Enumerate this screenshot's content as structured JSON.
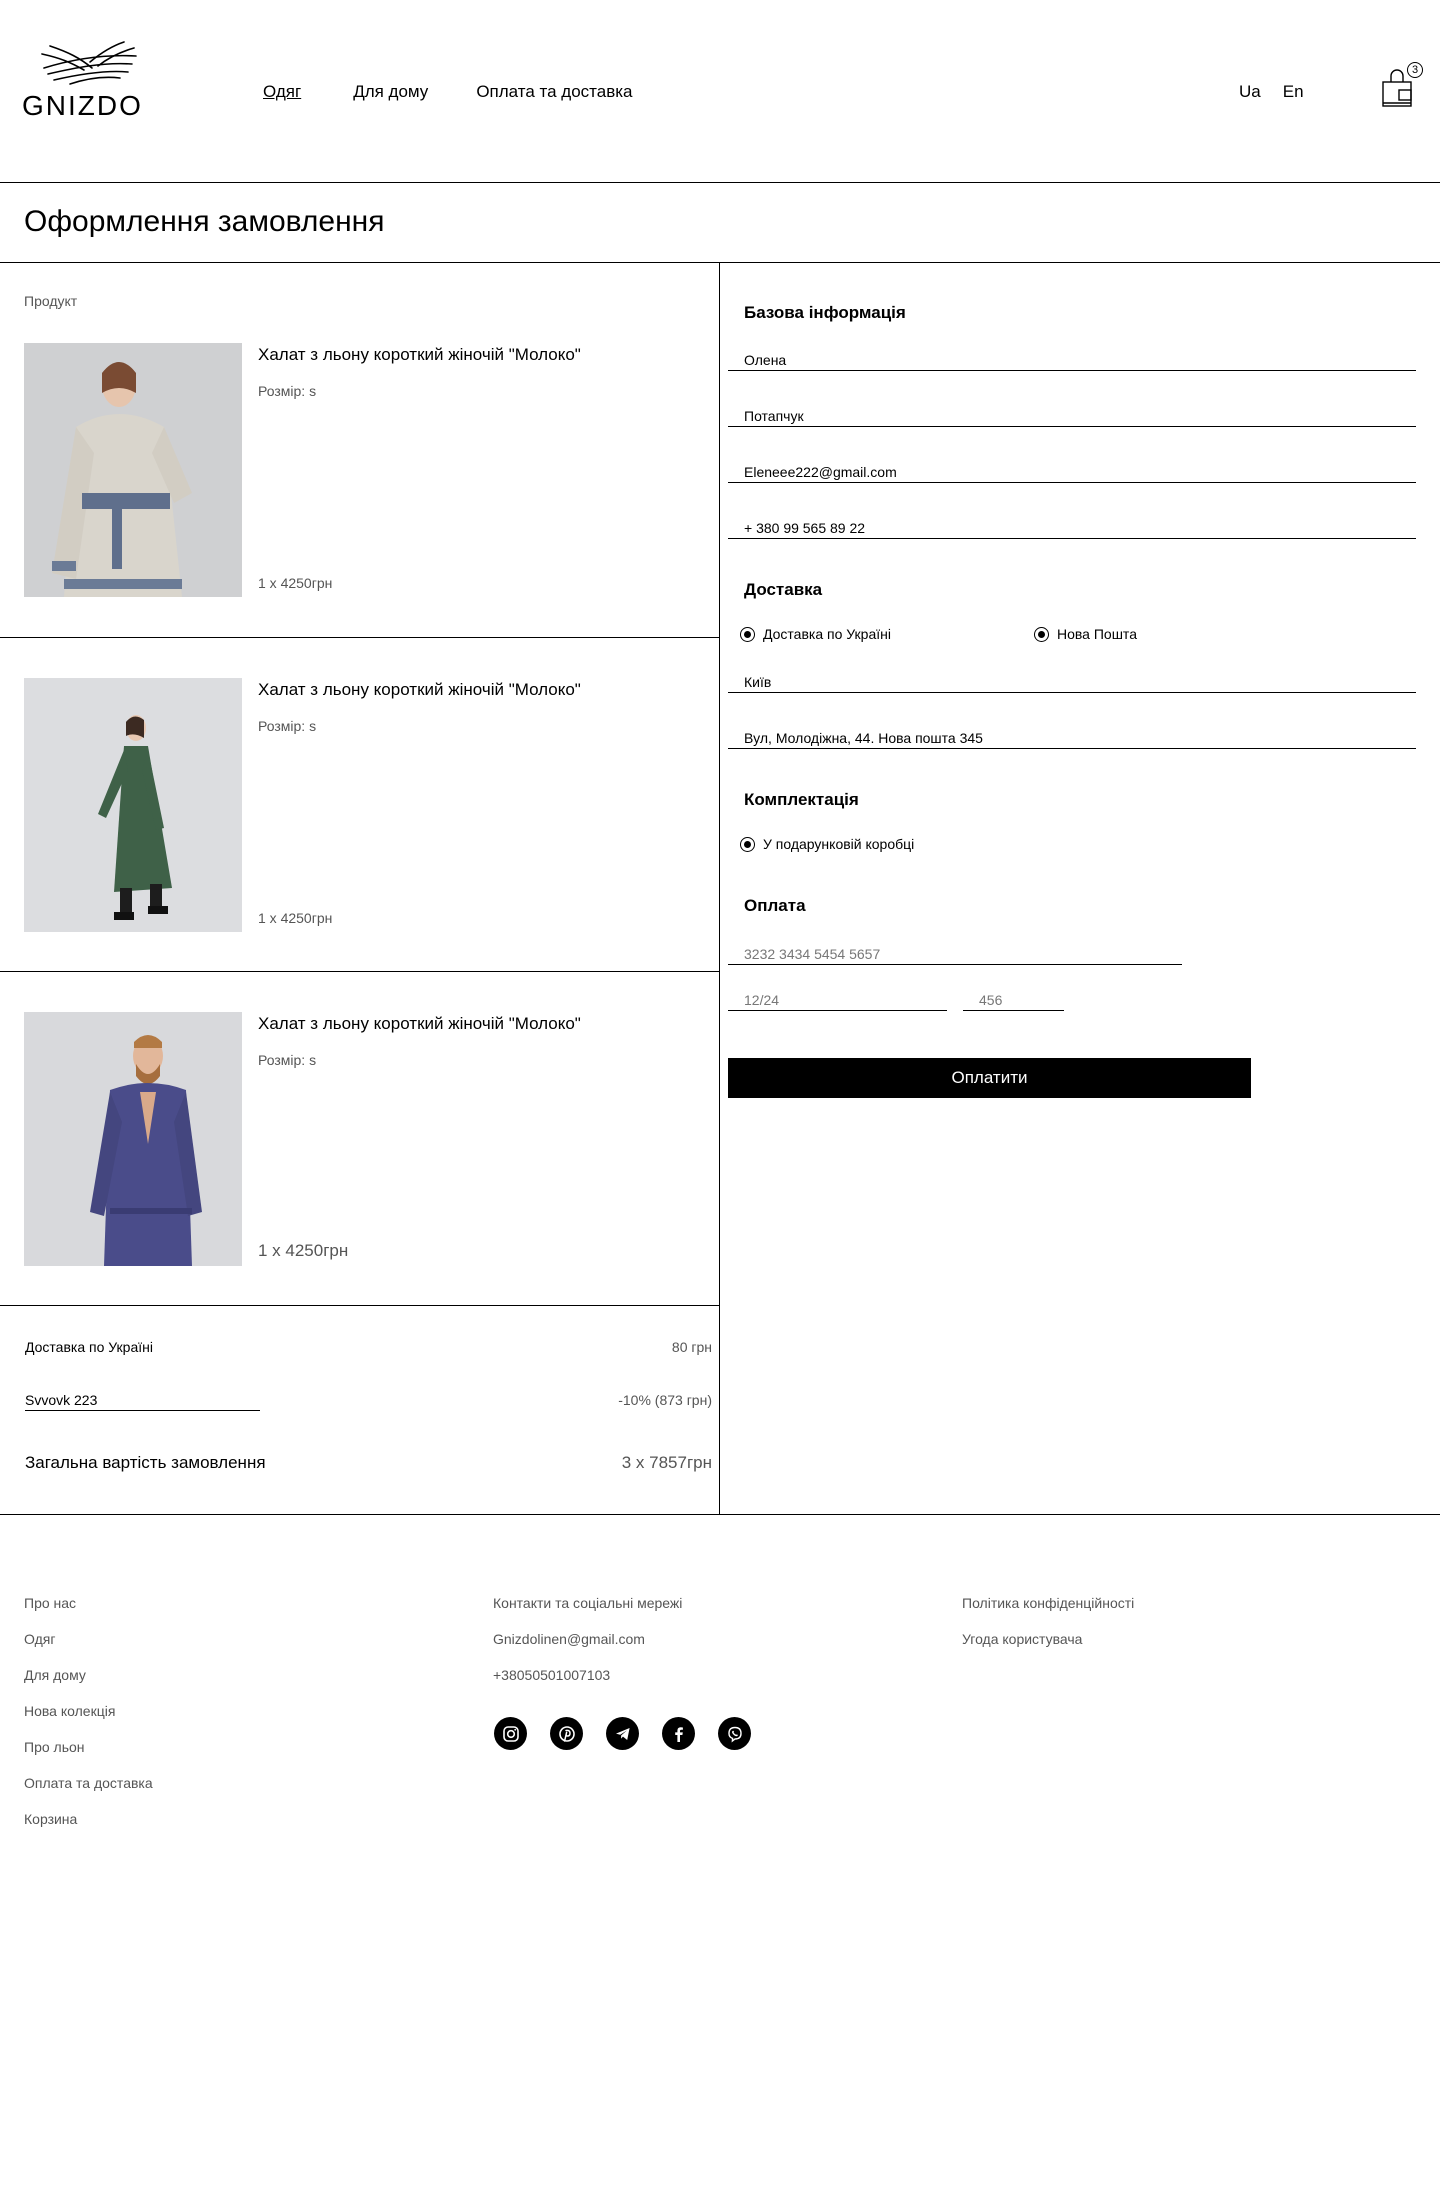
{
  "header": {
    "logo_text": "GNIZDO",
    "nav": [
      "Одяг",
      "Для дому",
      "Оплата та доставка"
    ],
    "lang": [
      "Ua",
      "En"
    ],
    "cart_count": "3"
  },
  "page_title": "Оформлення замовлення",
  "products_label": "Продукт",
  "products": [
    {
      "name": "Халат з льону короткий жіночій \"Молоко\"",
      "size": "Розмір: s",
      "price": "1 x 4250грн"
    },
    {
      "name": "Халат з льону короткий жіночій \"Молоко\"",
      "size": "Розмір: s",
      "price": "1 x 4250грн"
    },
    {
      "name": "Халат з льону короткий жіночій \"Молоко\"",
      "size": "Розмір: s",
      "price": "1 x 4250грн"
    }
  ],
  "summary": {
    "delivery_label": "Доставка по Україні",
    "delivery_value": "80 грн",
    "promo_code": "Svvovk 223",
    "discount_value": "-10% (873 грн)",
    "total_label": "Загальна вартість замовлення",
    "total_value": "3 x 7857грн"
  },
  "form": {
    "basic_title": "Базова інформація",
    "first_name": "Олена",
    "last_name": "Потапчук",
    "email": "Eleneee222@gmail.com",
    "phone": "+ 380 99 565 89 22",
    "delivery_title": "Доставка",
    "delivery_option_1": "Доставка по Україні",
    "delivery_option_2": "Нова Пошта",
    "city": "Київ",
    "address": "Вул, Молодіжна, 44. Нова пошта 345",
    "package_title": "Комплектація",
    "package_option": "У подарунковій коробці",
    "payment_title": "Оплата",
    "card_placeholder": "3232 3434 5454 5657",
    "expiry_placeholder": "12/24",
    "cvv_placeholder": "456",
    "pay_button": "Оплатити"
  },
  "footer": {
    "col1": [
      "Про нас",
      "Одяг",
      "Для дому",
      "Нова колекція",
      "Про льон",
      "Оплата та доставка",
      "Корзина"
    ],
    "col2": [
      "Контакти та соціальні мережі",
      "Gnizdolinen@gmail.com",
      "+38050501007103"
    ],
    "col3": [
      "Політика конфіденційності",
      "Угода користувача"
    ],
    "socials": [
      "instagram-icon",
      "pinterest-icon",
      "telegram-icon",
      "facebook-icon",
      "viber-icon"
    ]
  }
}
